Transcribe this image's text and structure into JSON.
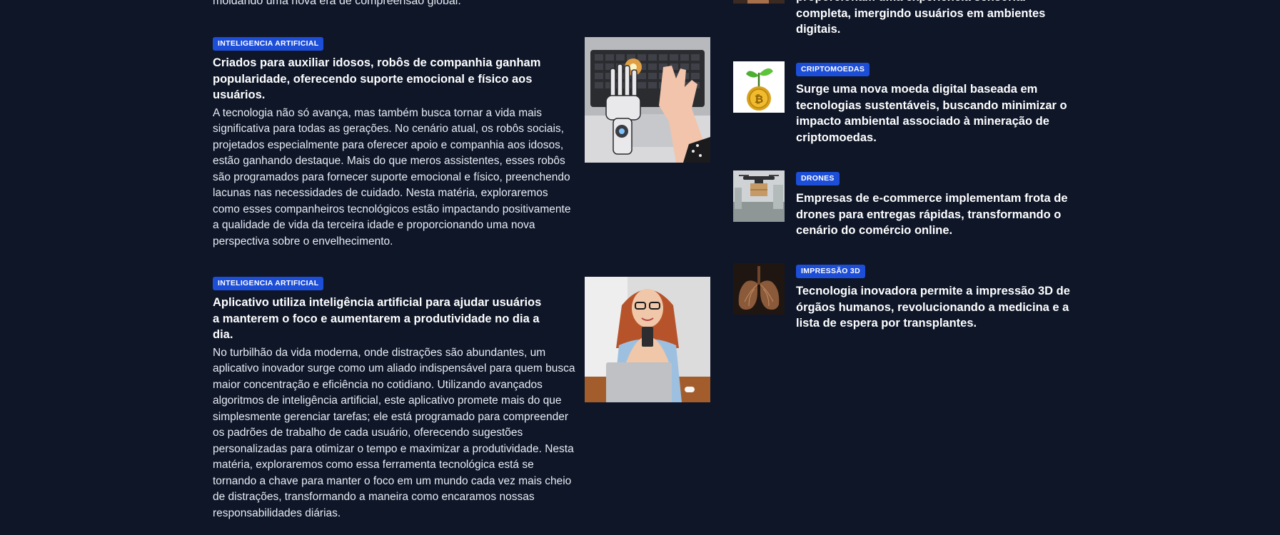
{
  "main": {
    "intro_line": "moldando uma nova era de compreensão global.",
    "articles": [
      {
        "category": "INTELIGENCIA ARTIFICIAL",
        "title": "Criados para auxiliar idosos, robôs de companhia ganham popularidade, oferecendo suporte emocional e físico aos usuários.",
        "body": "A tecnologia não só avança, mas também busca tornar a vida mais significativa para todas as gerações. No cenário atual, os robôs sociais, projetados especialmente para oferecer apoio e companhia aos idosos, estão ganhando destaque. Mais do que meros assistentes, esses robôs são programados para fornecer suporte emocional e físico, preenchendo lacunas nas necessidades de cuidado. Nesta matéria, exploraremos como esses companheiros tecnológicos estão impactando positivamente a qualidade de vida da terceira idade e proporcionando uma nova perspectiva sobre o envelhecimento.",
        "image": "robot-hand-typing-on-laptop"
      },
      {
        "category": "INTELIGENCIA ARTIFICIAL",
        "title": "Aplicativo utiliza inteligência artificial para ajudar usuários a manterem o foco e aumentarem a produtividade no dia a dia.",
        "body": "No turbilhão da vida moderna, onde distrações são abundantes, um aplicativo inovador surge como um aliado indispensável para quem busca maior concentração e eficiência no cotidiano. Utilizando avançados algoritmos de inteligência artificial, este aplicativo promete mais do que simplesmente gerenciar tarefas; ele está programado para compreender os padrões de trabalho de cada usuário, oferecendo sugestões personalizadas para otimizar o tempo e maximizar a produtividade. Nesta matéria, exploraremos como essa ferramenta tecnológica está se tornando a chave para manter o foco em um mundo cada vez mais cheio de distrações, transformando a maneira como encaramos nossas responsabilidades diárias.",
        "image": "woman-using-phone-at-laptop"
      }
    ]
  },
  "sidebar": {
    "top_partial_title": "proporcionam uma experiência sensorial completa, imergindo usuários em ambientes digitais.",
    "items": [
      {
        "category": "CRIPTOMOEDAS",
        "title": "Surge uma nova moeda digital baseada em tecnologias sustentáveis, buscando minimizar o impacto ambiental associado à mineração de criptomoedas.",
        "image": "bitcoin-plant"
      },
      {
        "category": "DRONES",
        "title": "Empresas de e-commerce implementam frota de drones para entregas rápidas, transformando o cenário do comércio online.",
        "image": "delivery-drone"
      },
      {
        "category": "IMPRESSÃO 3D",
        "title": "Tecnologia inovadora permite a impressão 3D de órgãos humanos, revolucionando a medicina e a lista de espera por transplantes.",
        "image": "printed-lungs"
      }
    ]
  },
  "colors": {
    "background": "#0e1628",
    "badge": "#1d4ed8",
    "text": "#ffffff"
  }
}
